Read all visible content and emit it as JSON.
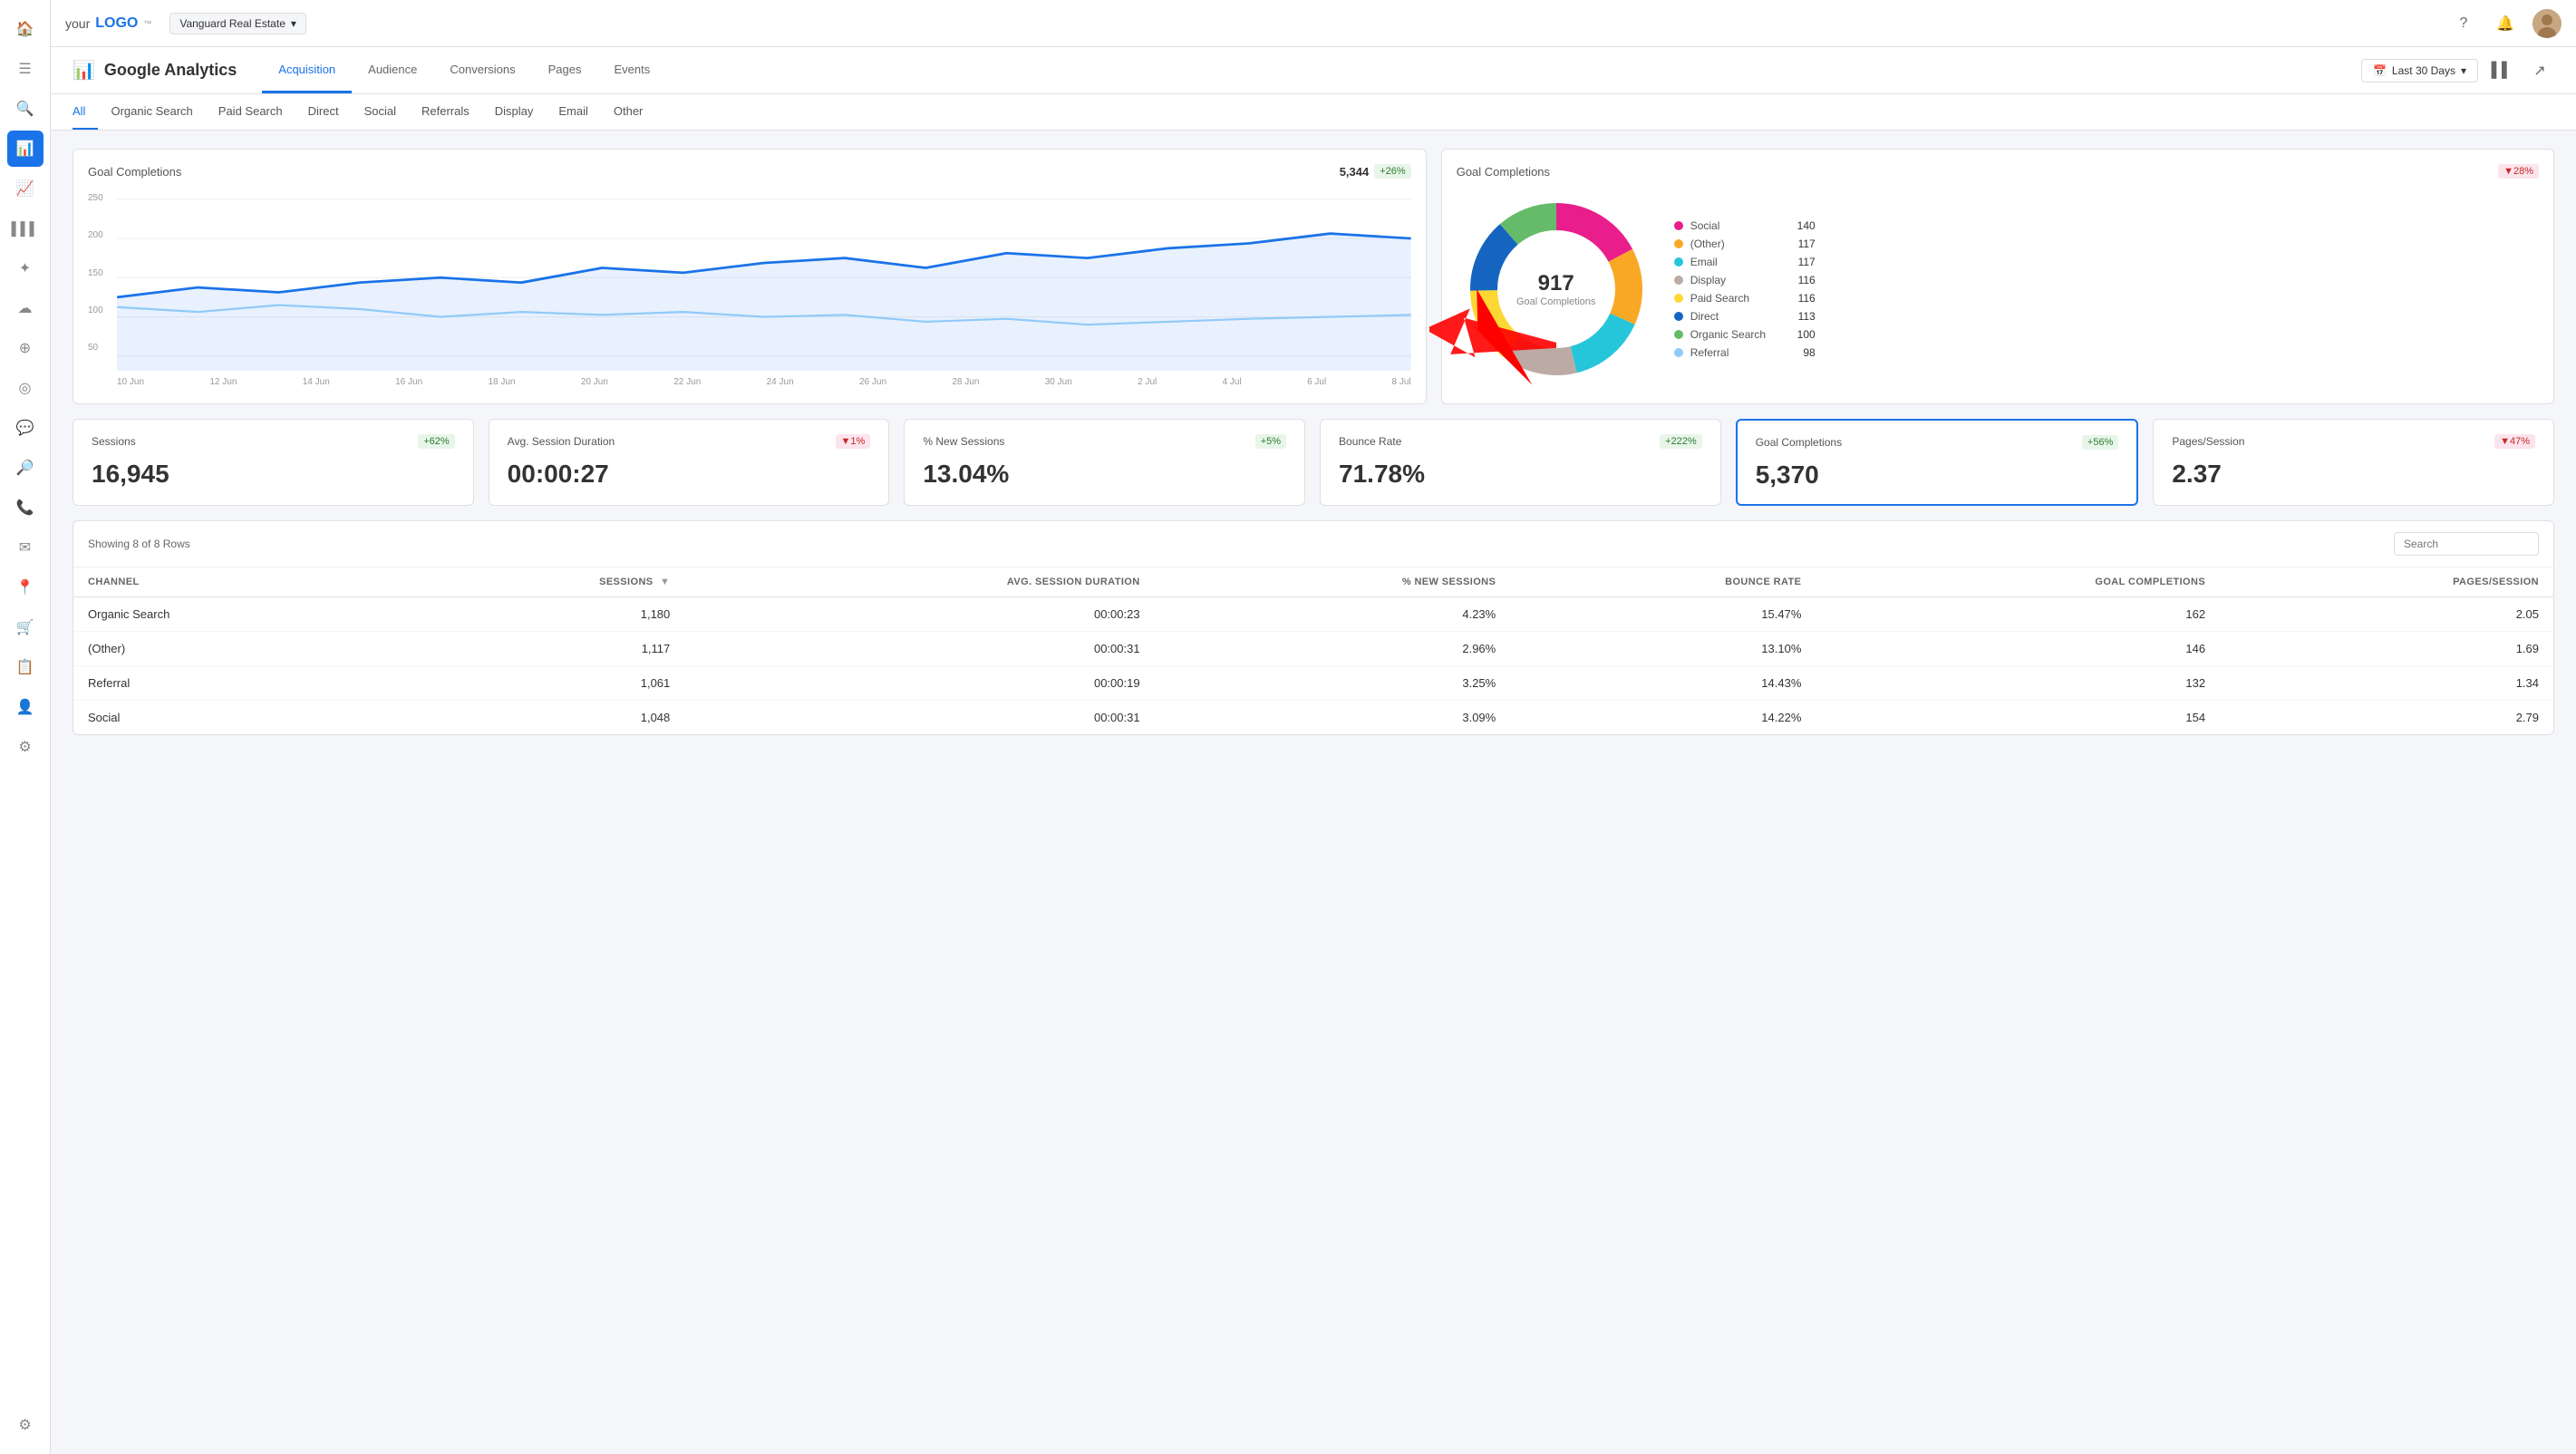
{
  "app": {
    "logo_your": "your",
    "logo_logo": "LOGO",
    "logo_tm": "™"
  },
  "topbar": {
    "dropdown_label": "Vanguard Real Estate",
    "help_icon": "?",
    "notification_icon": "🔔"
  },
  "page_header": {
    "title": "Google Analytics",
    "tabs": [
      "Acquisition",
      "Audience",
      "Conversions",
      "Pages",
      "Events"
    ],
    "active_tab": "Acquisition",
    "date_label": "Last 30 Days"
  },
  "sub_nav": {
    "items": [
      "All",
      "Organic Search",
      "Paid Search",
      "Direct",
      "Social",
      "Referrals",
      "Display",
      "Email",
      "Other"
    ],
    "active": "All"
  },
  "goal_chart": {
    "title": "Goal Completions",
    "value": "5,344",
    "badge": "+26%",
    "badge_type": "up",
    "y_labels": [
      "250",
      "200",
      "150",
      "100",
      "50"
    ],
    "x_labels": [
      "10 Jun",
      "12 Jun",
      "14 Jun",
      "16 Jun",
      "18 Jun",
      "20 Jun",
      "22 Jun",
      "24 Jun",
      "26 Jun",
      "28 Jun",
      "30 Jun",
      "2 Jul",
      "4 Jul",
      "6 Jul",
      "8 Jul"
    ]
  },
  "donut_chart": {
    "title": "Goal Completions",
    "badge": "▼28%",
    "badge_type": "down",
    "center_value": "917",
    "center_label": "Goal Completions",
    "legend": [
      {
        "label": "Social",
        "value": "140",
        "color": "#e91e8c"
      },
      {
        "label": "(Other)",
        "value": "117",
        "color": "#f9a825"
      },
      {
        "label": "Email",
        "value": "117",
        "color": "#26c6da"
      },
      {
        "label": "Display",
        "value": "116",
        "color": "#bcaaa4"
      },
      {
        "label": "Paid Search",
        "value": "116",
        "color": "#fdd835"
      },
      {
        "label": "Direct",
        "value": "113",
        "color": "#1565c0"
      },
      {
        "label": "Organic Search",
        "value": "100",
        "color": "#66bb6a"
      },
      {
        "label": "Referral",
        "value": "98",
        "color": "#90caf9"
      }
    ]
  },
  "stats": [
    {
      "title": "Sessions",
      "value": "16,945",
      "badge": "+62%",
      "badge_type": "up",
      "highlighted": false
    },
    {
      "title": "Avg. Session Duration",
      "value": "00:00:27",
      "badge": "▼1%",
      "badge_type": "down",
      "highlighted": false
    },
    {
      "title": "% New Sessions",
      "value": "13.04%",
      "badge": "+5%",
      "badge_type": "up",
      "highlighted": false
    },
    {
      "title": "Bounce Rate",
      "value": "71.78%",
      "badge": "+222%",
      "badge_type": "up",
      "highlighted": false
    },
    {
      "title": "Goal Completions",
      "value": "5,370",
      "badge": "+56%",
      "badge_type": "up",
      "highlighted": true
    },
    {
      "title": "Pages/Session",
      "value": "2.37",
      "badge": "▼47%",
      "badge_type": "down",
      "highlighted": false
    }
  ],
  "table": {
    "showing_text": "Showing 8 of 8 Rows",
    "search_placeholder": "Search",
    "columns": [
      "CHANNEL",
      "SESSIONS",
      "AVG. SESSION DURATION",
      "% NEW SESSIONS",
      "BOUNCE RATE",
      "GOAL COMPLETIONS",
      "PAGES/SESSION"
    ],
    "rows": [
      {
        "channel": "Organic Search",
        "sessions": "1,180",
        "avg_session": "00:00:23",
        "new_sessions": "4.23%",
        "bounce_rate": "15.47%",
        "goal_completions": "162",
        "pages_session": "2.05"
      },
      {
        "channel": "(Other)",
        "sessions": "1,117",
        "avg_session": "00:00:31",
        "new_sessions": "2.96%",
        "bounce_rate": "13.10%",
        "goal_completions": "146",
        "pages_session": "1.69"
      },
      {
        "channel": "Referral",
        "sessions": "1,061",
        "avg_session": "00:00:19",
        "new_sessions": "3.25%",
        "bounce_rate": "14.43%",
        "goal_completions": "132",
        "pages_session": "1.34"
      },
      {
        "channel": "Social",
        "sessions": "1,048",
        "avg_session": "00:00:31",
        "new_sessions": "3.09%",
        "bounce_rate": "14.22%",
        "goal_completions": "154",
        "pages_session": "2.79"
      }
    ]
  },
  "sidebar": {
    "items": [
      {
        "icon": "⊞",
        "name": "dashboard"
      },
      {
        "icon": "☰",
        "name": "menu"
      },
      {
        "icon": "🔍",
        "name": "search"
      },
      {
        "icon": "●",
        "name": "active-indicator"
      },
      {
        "icon": "📊",
        "name": "charts"
      },
      {
        "icon": "📈",
        "name": "analytics"
      },
      {
        "icon": "✦",
        "name": "star"
      },
      {
        "icon": "☁",
        "name": "cloud"
      },
      {
        "icon": "⊕",
        "name": "add"
      },
      {
        "icon": "◎",
        "name": "target"
      },
      {
        "icon": "💬",
        "name": "messages"
      },
      {
        "icon": "🔎",
        "name": "explore"
      },
      {
        "icon": "📞",
        "name": "phone"
      },
      {
        "icon": "✉",
        "name": "email"
      },
      {
        "icon": "📍",
        "name": "location"
      },
      {
        "icon": "🛒",
        "name": "cart"
      },
      {
        "icon": "📋",
        "name": "reports"
      },
      {
        "icon": "👤",
        "name": "user"
      },
      {
        "icon": "⚙",
        "name": "gear"
      },
      {
        "icon": "⚙",
        "name": "settings"
      }
    ]
  }
}
